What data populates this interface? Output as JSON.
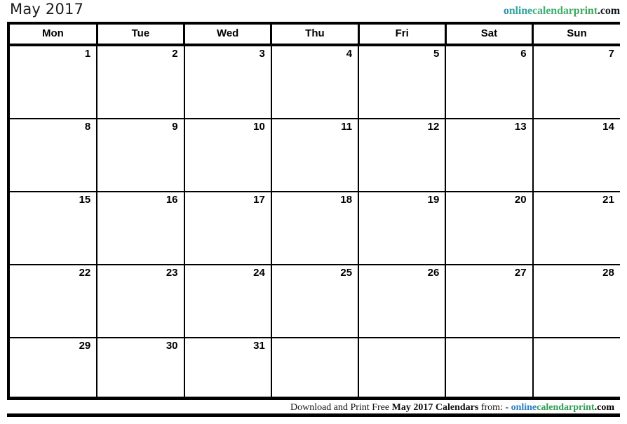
{
  "header": {
    "title": "May 2017",
    "brand": {
      "segments": [
        "o",
        "nline",
        "calen",
        "dar",
        "print"
      ],
      "part1": "onlineca",
      "part2": "lendarprint",
      "domain": ".com",
      "full": "onlinecalendarprint.com"
    }
  },
  "calendar": {
    "month": "May",
    "year": "2017",
    "weekday_headers": [
      "Mon",
      "Tue",
      "Wed",
      "Thu",
      "Fri",
      "Sat",
      "Sun"
    ],
    "weeks": [
      [
        "1",
        "2",
        "3",
        "4",
        "5",
        "6",
        "7"
      ],
      [
        "8",
        "9",
        "10",
        "11",
        "12",
        "13",
        "14"
      ],
      [
        "15",
        "16",
        "17",
        "18",
        "19",
        "20",
        "21"
      ],
      [
        "22",
        "23",
        "24",
        "25",
        "26",
        "27",
        "28"
      ],
      [
        "29",
        "30",
        "31",
        "",
        "",
        "",
        ""
      ]
    ]
  },
  "footer": {
    "lead": "Download and Print Free ",
    "emphasis": "May 2017 Calendars",
    "mid": " from: - ",
    "link_online": "online",
    "link_calprint": "calendarprint",
    "link_domain": ".com"
  },
  "colors": {
    "border": "#000000",
    "text": "#000000",
    "background": "#ffffff",
    "brand_teal": "#2f8fa8",
    "brand_green": "#43b267",
    "footer_blue": "#2b7fc4",
    "footer_green": "#2f9e52"
  }
}
